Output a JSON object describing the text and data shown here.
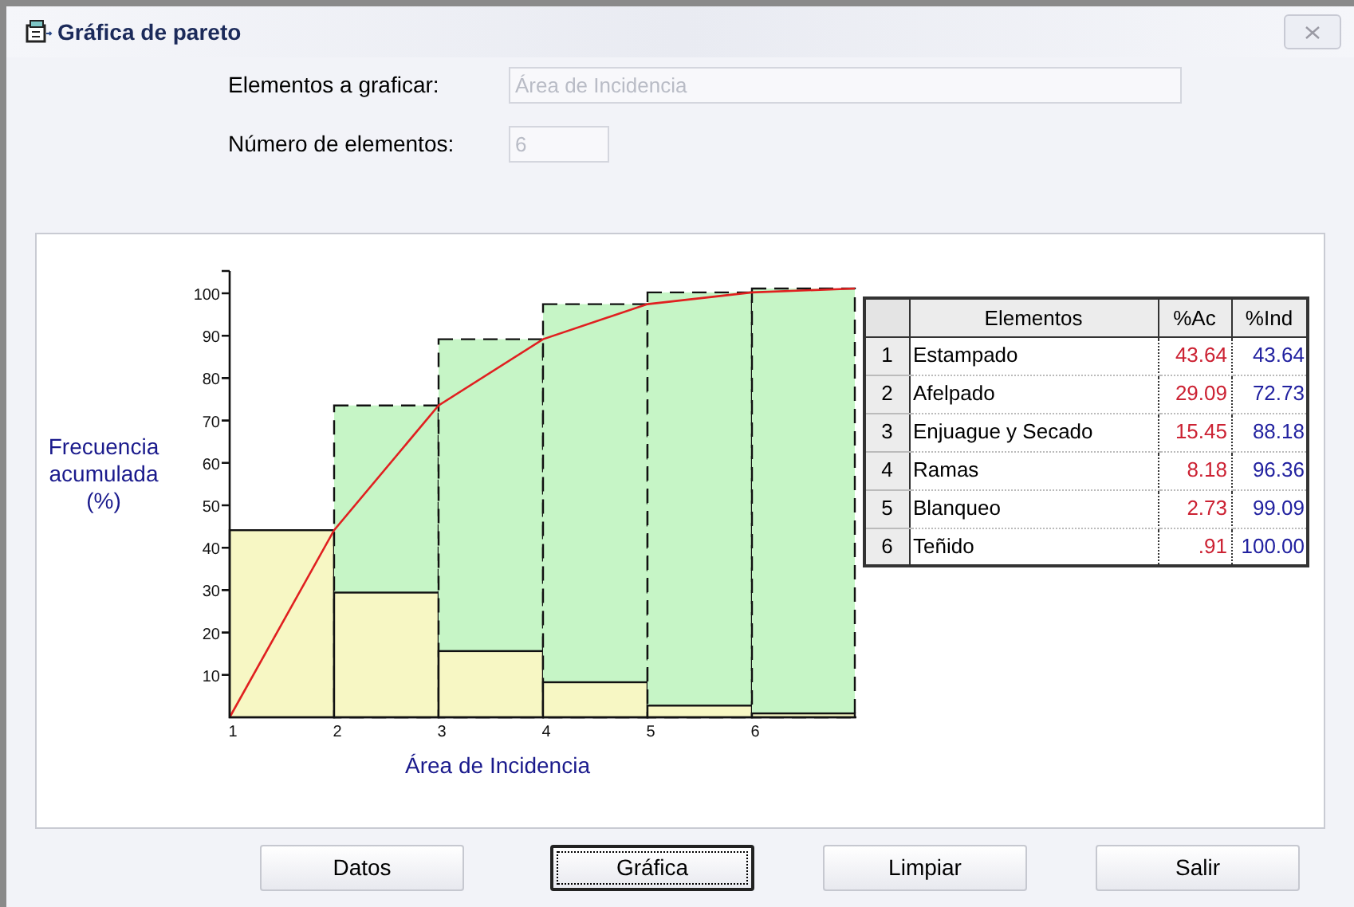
{
  "window": {
    "title": "Gráfica de pareto"
  },
  "form": {
    "fields": [
      {
        "label": "Elementos a graficar:",
        "value": "Área de Incidencia",
        "disabled": true
      },
      {
        "label": "Número de elementos:",
        "value": "6",
        "disabled": true
      }
    ]
  },
  "chart": {
    "ylabel_lines": [
      "Frecuencia",
      "acumulada",
      "(%)"
    ],
    "xlabel": "Área de Incidencia",
    "y_tick_labels": [
      "100",
      "90",
      "80",
      "70",
      "60",
      "50",
      "40",
      "30",
      "20",
      "10"
    ],
    "x_tick_labels": [
      "1",
      "2",
      "3",
      "4",
      "5",
      "6"
    ]
  },
  "table": {
    "columns": [
      "Elementos",
      "%Ac",
      "%Ind"
    ],
    "rows": [
      {
        "index": "1",
        "name": "Estampado",
        "ac": "43.64",
        "ind": "43.64"
      },
      {
        "index": "2",
        "name": "Afelpado",
        "ac": "29.09",
        "ind": "72.73"
      },
      {
        "index": "3",
        "name": "Enjuague y Secado",
        "ac": "15.45",
        "ind": "88.18"
      },
      {
        "index": "4",
        "name": "Ramas",
        "ac": "8.18",
        "ind": "96.36"
      },
      {
        "index": "5",
        "name": "Blanqueo",
        "ac": "2.73",
        "ind": "99.09"
      },
      {
        "index": "6",
        "name": "Teñido",
        "ac": ".91",
        "ind": "100.00"
      }
    ]
  },
  "buttons": [
    {
      "label": "Datos",
      "focused": false
    },
    {
      "label": "Gráfica",
      "focused": true
    },
    {
      "label": "Limpiar",
      "focused": false
    },
    {
      "label": "Salir",
      "focused": false
    }
  ]
}
